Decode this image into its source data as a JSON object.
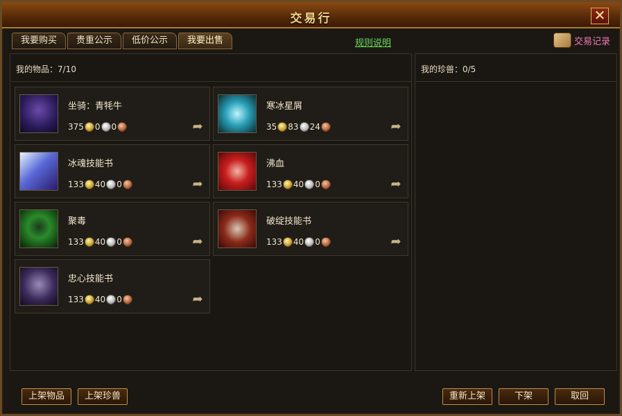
{
  "window": {
    "title": "交易行",
    "close_label": "✕"
  },
  "tabs": [
    {
      "label": "我要购买"
    },
    {
      "label": "贵重公示"
    },
    {
      "label": "低价公示"
    },
    {
      "label": "我要出售"
    }
  ],
  "rules_link": "规则说明",
  "trade_record": "交易记录",
  "left_panel": {
    "header": "我的物品：7/10"
  },
  "right_panel": {
    "header": "我的珍兽：0/5"
  },
  "items": [
    {
      "name": "坐骑：青牦牛",
      "gold": "375",
      "silver": "0",
      "copper": "0",
      "icon": "mount-bull-icon"
    },
    {
      "name": "寒冰星屑",
      "gold": "35",
      "silver": "83",
      "copper": "24",
      "icon": "frost-stardust-icon"
    },
    {
      "name": "冰魂技能书",
      "gold": "133",
      "silver": "40",
      "copper": "0",
      "icon": "ice-soul-skillbook-icon"
    },
    {
      "name": "沸血",
      "gold": "133",
      "silver": "40",
      "copper": "0",
      "icon": "boiling-blood-icon"
    },
    {
      "name": "聚毒",
      "gold": "133",
      "silver": "40",
      "copper": "0",
      "icon": "gather-poison-icon"
    },
    {
      "name": "破绽技能书",
      "gold": "133",
      "silver": "40",
      "copper": "0",
      "icon": "flaw-skillbook-icon"
    },
    {
      "name": "忠心技能书",
      "gold": "133",
      "silver": "40",
      "copper": "0",
      "icon": "loyalty-skillbook-icon"
    }
  ],
  "buttons": {
    "list_item": "上架物品",
    "list_pet": "上架珍兽",
    "relist": "重新上架",
    "delist": "下架",
    "cancel": "取回"
  },
  "colors": {
    "title_text": "#f2d58a",
    "rules_link": "#6ddc5a",
    "trade_record": "#f07ab0",
    "button_border": "#c09048"
  }
}
